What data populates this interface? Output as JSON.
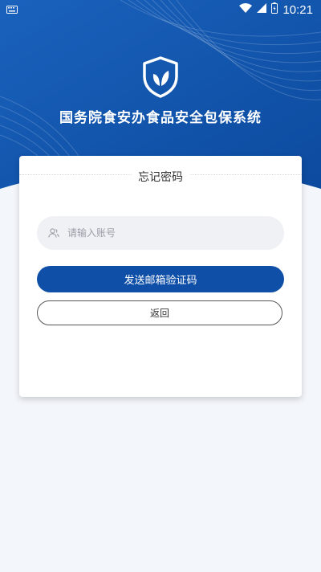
{
  "status_bar": {
    "time": "10:21"
  },
  "app": {
    "title": "国务院食安办食品安全包保系统"
  },
  "card": {
    "title": "忘记密码",
    "account_placeholder": "请输入账号",
    "send_button": "发送邮箱验证码",
    "back_button": "返回"
  },
  "colors": {
    "header_blue": "#1557ad",
    "primary_button": "#0f4fa8",
    "page_background": "#f3f6fb"
  }
}
